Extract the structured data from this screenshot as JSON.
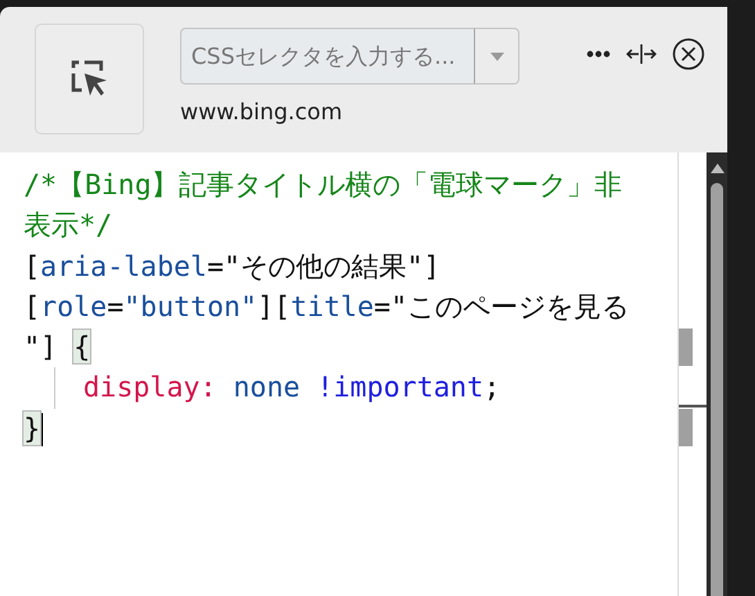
{
  "header": {
    "selector_field": {
      "placeholder": "CSSセレクタを入力する..."
    },
    "url": "www.bing.com"
  },
  "code": {
    "lines": [
      {
        "tokens": [
          {
            "text": "/*【Bing】記事タイトル横の「電球マーク」非",
            "kind": "comment"
          }
        ]
      },
      {
        "tokens": [
          {
            "text": "表示*/",
            "kind": "comment"
          }
        ]
      },
      {
        "tokens": [
          {
            "text": "[",
            "kind": "plain"
          },
          {
            "text": "aria-label",
            "kind": "attr"
          },
          {
            "text": "=\"その他の結果\"]",
            "kind": "plain"
          }
        ]
      },
      {
        "tokens": [
          {
            "text": "[",
            "kind": "plain"
          },
          {
            "text": "role",
            "kind": "attr"
          },
          {
            "text": "=",
            "kind": "plain"
          },
          {
            "text": "\"button\"",
            "kind": "attr"
          },
          {
            "text": "][",
            "kind": "plain"
          },
          {
            "text": "title",
            "kind": "attr"
          },
          {
            "text": "=\"このページを見る",
            "kind": "plain"
          }
        ]
      },
      {
        "tokens": [
          {
            "text": "\"] ",
            "kind": "plain"
          },
          {
            "text": "{",
            "kind": "bracket-match"
          }
        ]
      },
      {
        "indent_guide": true,
        "tokens": [
          {
            "text": "display:",
            "kind": "property"
          },
          {
            "text": " none",
            "kind": "value"
          },
          {
            "text": " !important",
            "kind": "important"
          },
          {
            "text": ";",
            "kind": "plain"
          }
        ]
      },
      {
        "cursor": true,
        "tokens": [
          {
            "text": "}",
            "kind": "bracket-match"
          }
        ]
      }
    ]
  }
}
